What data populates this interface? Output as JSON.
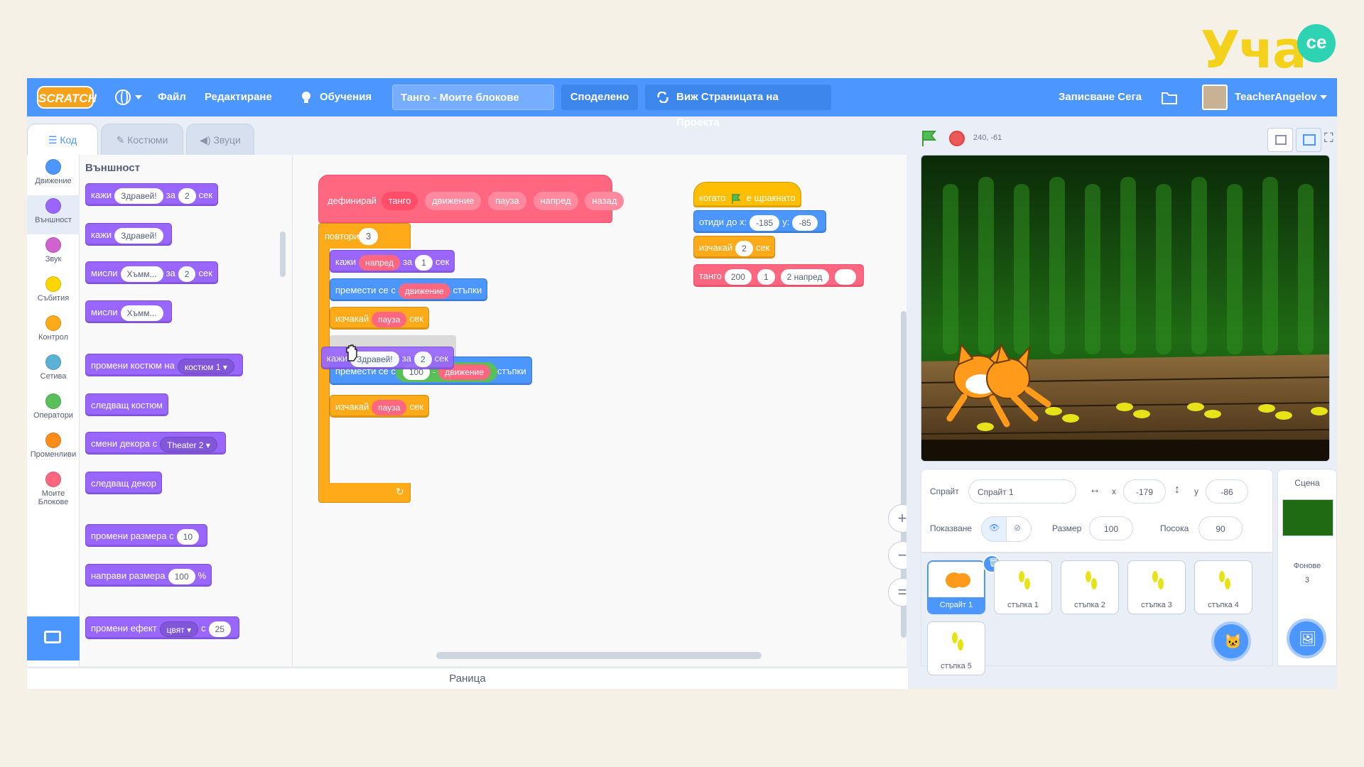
{
  "brand": {
    "logo_text": "Уча",
    "bubble_text": "се"
  },
  "menubar": {
    "logo": "SCRATCH",
    "file": "Файл",
    "edit": "Редактиране",
    "tutorials": "Обучения",
    "project_title": "Танго - Моите блокове",
    "shared": "Споделено",
    "see_project": "Виж Страницата на Проекта",
    "save_now": "Записване Сега",
    "username": "TeacherAngelov"
  },
  "tabs": {
    "code": "Код",
    "costumes": "Костюми",
    "sounds": "Звуци"
  },
  "categories": [
    {
      "label": "Движение",
      "color": "#4c97ff"
    },
    {
      "label": "Външност",
      "color": "#9966ff"
    },
    {
      "label": "Звук",
      "color": "#cf63cf"
    },
    {
      "label": "Събития",
      "color": "#ffd500"
    },
    {
      "label": "Контрол",
      "color": "#ffab19"
    },
    {
      "label": "Сетива",
      "color": "#5cb1d6"
    },
    {
      "label": "Оператори",
      "color": "#59c059"
    },
    {
      "label": "Променливи",
      "color": "#ff8c1a"
    },
    {
      "label": "Моите Блокове",
      "color": "#ff6680"
    }
  ],
  "palette": {
    "heading": "Външност",
    "say_secs": {
      "a": "кажи",
      "msg": "Здравей!",
      "b": "за",
      "n": "2",
      "c": "сек"
    },
    "say": {
      "a": "кажи",
      "msg": "Здравей!"
    },
    "think_secs": {
      "a": "мисли",
      "msg": "Хъмм...",
      "b": "за",
      "n": "2",
      "c": "сек"
    },
    "think": {
      "a": "мисли",
      "msg": "Хъмм..."
    },
    "switch_costume": {
      "a": "промени костюм на",
      "val": "костюм 1 ▾"
    },
    "next_costume": "следващ костюм",
    "switch_backdrop": {
      "a": "смени декора с",
      "val": "Theater 2 ▾"
    },
    "next_backdrop": "следващ декор",
    "change_size": {
      "a": "промени размера с",
      "n": "10"
    },
    "set_size": {
      "a": "направи размера",
      "n": "100",
      "b": "%"
    },
    "change_effect": {
      "a": "промени ефект",
      "val": "цвят ▾",
      "b": "с",
      "n": "25"
    }
  },
  "script1": {
    "define": "дефинирай",
    "name": "танго",
    "params": [
      "движение",
      "пауза",
      "напред",
      "назад"
    ],
    "repeat": "повтори",
    "repeat_n": "3",
    "say": {
      "a": "кажи",
      "msg": "напред",
      "b": "за",
      "n": "1",
      "c": "сек"
    },
    "move1": {
      "a": "премести се с",
      "p": "движение",
      "b": "стъпки"
    },
    "wait1": {
      "a": "изчакай",
      "p": "пауза",
      "b": "сек"
    },
    "drag_say": {
      "a": "кажи",
      "msg": "Здравей!",
      "b": "за",
      "n": "2",
      "c": "сек"
    },
    "move2": {
      "a": "премести се с",
      "n": "100",
      "op": "-",
      "p": "движение",
      "b": "стъпки"
    },
    "wait2": {
      "a": "изчакай",
      "p": "пауза",
      "b": "сек"
    }
  },
  "script2": {
    "hat": {
      "a": "когато",
      "b": "е щракнато"
    },
    "goto": {
      "a": "отиди до x:",
      "x": "-185",
      "b": "y:",
      "y": "-85"
    },
    "wait": {
      "a": "изчакай",
      "n": "2",
      "b": "сек"
    },
    "tango": {
      "a": "танго",
      "v1": "200",
      "v2": "1",
      "v3": "2 напред",
      "v4": ""
    }
  },
  "zoom": {
    "in": "+",
    "out": "−",
    "reset": "="
  },
  "backpack": "Раница",
  "stage_header": {
    "coords": "240, -61"
  },
  "sprite_info": {
    "sprite_label": "Спрайт",
    "sprite_name": "Спрайт 1",
    "x_label": "x",
    "x": "-179",
    "y_label": "y",
    "y": "-86",
    "show_label": "Показване",
    "size_label": "Размер",
    "size": "100",
    "direction_label": "Посока",
    "direction": "90"
  },
  "sprites": [
    {
      "name": "Спрайт 1"
    },
    {
      "name": "стъпка 1"
    },
    {
      "name": "стъпка 2"
    },
    {
      "name": "стъпка 3"
    },
    {
      "name": "стъпка 4"
    },
    {
      "name": "стъпка 5"
    }
  ],
  "stage_panel": {
    "title": "Сцена",
    "backdrops_label": "Фонове",
    "backdrops_count": "3"
  }
}
